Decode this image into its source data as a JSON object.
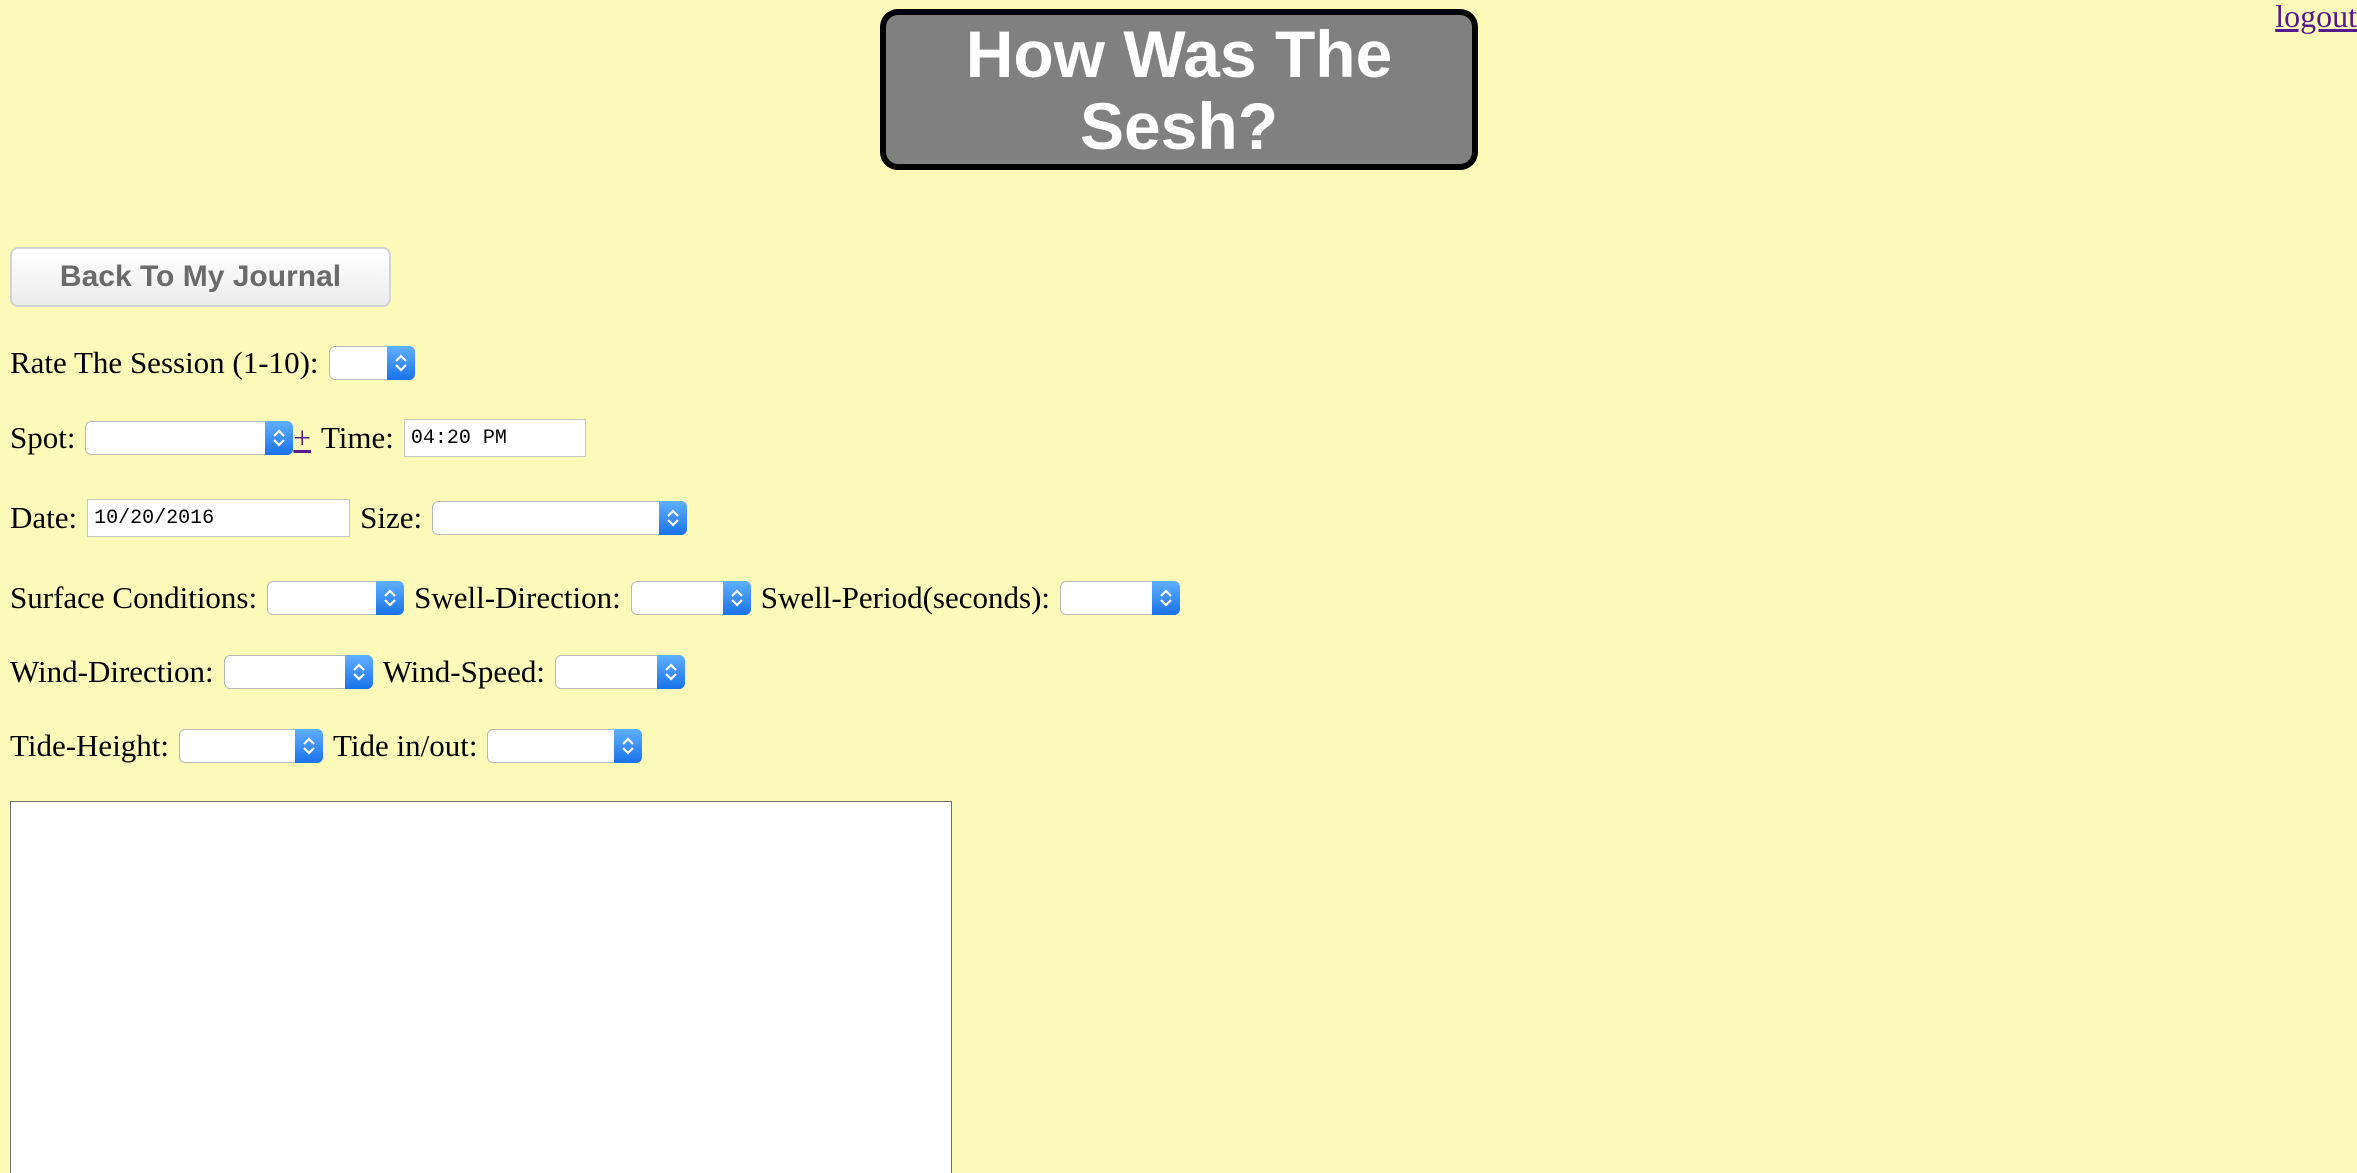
{
  "header": {
    "logout_label": "logout",
    "title": "How Was The Sesh?"
  },
  "nav": {
    "back_label": "Back To My Journal"
  },
  "form": {
    "rating": {
      "label": "Rate The Session (1-10):",
      "value": ""
    },
    "spot": {
      "label": "Spot:",
      "value": "",
      "add_label": "+"
    },
    "time": {
      "label": "Time:",
      "value": "04:20 PM"
    },
    "date": {
      "label": "Date:",
      "value": "10/20/2016"
    },
    "size": {
      "label": "Size:",
      "value": ""
    },
    "surface": {
      "label": "Surface Conditions:",
      "value": ""
    },
    "swell_direction": {
      "label": "Swell-Direction:",
      "value": ""
    },
    "swell_period": {
      "label": "Swell-Period(seconds):",
      "value": ""
    },
    "wind_direction": {
      "label": "Wind-Direction:",
      "value": ""
    },
    "wind_speed": {
      "label": "Wind-Speed:",
      "value": ""
    },
    "tide_height": {
      "label": "Tide-Height:",
      "value": ""
    },
    "tide_inout": {
      "label": "Tide in/out:",
      "value": ""
    },
    "notes": {
      "value": ""
    }
  },
  "icons": {
    "select_arrow": "up-down-chevron-icon"
  },
  "colors": {
    "background": "#fcfab9",
    "title_box": "#808080",
    "select_accent": "#1a72e8",
    "link": "#551a8b"
  }
}
